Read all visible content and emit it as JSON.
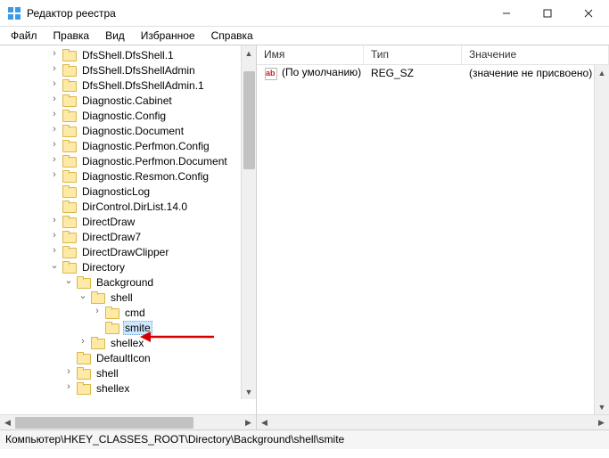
{
  "window": {
    "title": "Редактор реестра"
  },
  "menu": {
    "file": "Файл",
    "edit": "Правка",
    "view": "Вид",
    "favorites": "Избранное",
    "help": "Справка"
  },
  "tree": [
    {
      "indent": 2,
      "exp": "closed",
      "label": "DfsShell.DfsShell.1"
    },
    {
      "indent": 2,
      "exp": "closed",
      "label": "DfsShell.DfsShellAdmin"
    },
    {
      "indent": 2,
      "exp": "closed",
      "label": "DfsShell.DfsShellAdmin.1"
    },
    {
      "indent": 2,
      "exp": "closed",
      "label": "Diagnostic.Cabinet"
    },
    {
      "indent": 2,
      "exp": "closed",
      "label": "Diagnostic.Config"
    },
    {
      "indent": 2,
      "exp": "closed",
      "label": "Diagnostic.Document"
    },
    {
      "indent": 2,
      "exp": "closed",
      "label": "Diagnostic.Perfmon.Config"
    },
    {
      "indent": 2,
      "exp": "closed",
      "label": "Diagnostic.Perfmon.Document"
    },
    {
      "indent": 2,
      "exp": "closed",
      "label": "Diagnostic.Resmon.Config"
    },
    {
      "indent": 2,
      "exp": "none",
      "label": "DiagnosticLog"
    },
    {
      "indent": 2,
      "exp": "none",
      "label": "DirControl.DirList.14.0"
    },
    {
      "indent": 2,
      "exp": "closed",
      "label": "DirectDraw"
    },
    {
      "indent": 2,
      "exp": "closed",
      "label": "DirectDraw7"
    },
    {
      "indent": 2,
      "exp": "closed",
      "label": "DirectDrawClipper"
    },
    {
      "indent": 2,
      "exp": "open",
      "label": "Directory"
    },
    {
      "indent": 3,
      "exp": "open",
      "label": "Background"
    },
    {
      "indent": 4,
      "exp": "open",
      "label": "shell"
    },
    {
      "indent": 5,
      "exp": "closed",
      "label": "cmd"
    },
    {
      "indent": 5,
      "exp": "none",
      "label": "smite",
      "selected": true
    },
    {
      "indent": 4,
      "exp": "closed",
      "label": "shellex"
    },
    {
      "indent": 3,
      "exp": "none",
      "label": "DefaultIcon"
    },
    {
      "indent": 3,
      "exp": "closed",
      "label": "shell"
    },
    {
      "indent": 3,
      "exp": "closed",
      "label": "shellex"
    }
  ],
  "columns": {
    "name": "Имя",
    "type": "Тип",
    "value": "Значение"
  },
  "rows": [
    {
      "name": "(По умолчанию)",
      "type": "REG_SZ",
      "value": "(значение не присвоено)"
    }
  ],
  "status": {
    "path": "Компьютер\\HKEY_CLASSES_ROOT\\Directory\\Background\\shell\\smite"
  }
}
